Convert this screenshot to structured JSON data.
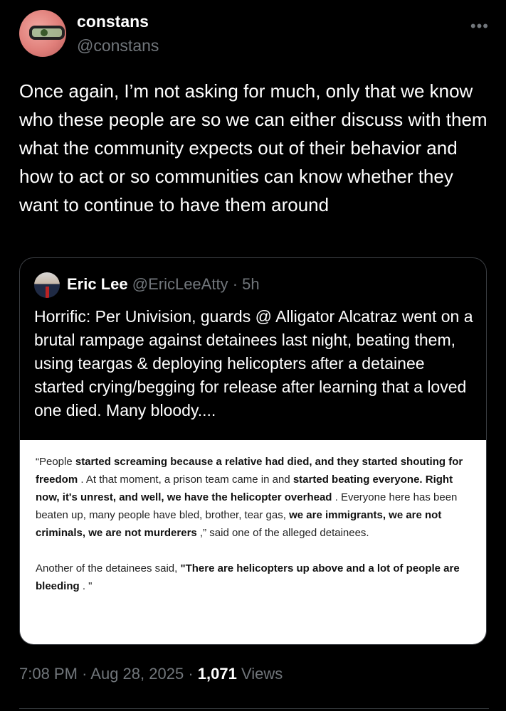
{
  "author": {
    "display_name": "constans",
    "handle": "@constans",
    "more_icon": "ellipsis-icon"
  },
  "tweet": {
    "text": "Once again, I’m not asking for much, only that we know who these people are so we can either discuss with them what the community expects out of their behavior and how to act or so communities can know whether they want to continue to have them around"
  },
  "quote": {
    "name": "Eric Lee",
    "handle": "@EricLeeAtty",
    "sep": "·",
    "time": "5h",
    "text": "Horrific: Per Univision, guards @ Alligator Alcatraz went on a brutal rampage against detainees last night, beating them, using teargas & deploying helicopters after a detainee started crying/begging for release after learning that a loved one died. Many bloody....",
    "image": {
      "p1": [
        {
          "t": "“People ",
          "b": false
        },
        {
          "t": "started screaming because a relative had died, and they started shouting for freedom",
          "b": true
        },
        {
          "t": " . At that moment, a prison team came in and ",
          "b": false
        },
        {
          "t": "started beating everyone. Right now, it's unrest, and well, we have the helicopter overhead",
          "b": true
        },
        {
          "t": " . Everyone here has been beaten up, many people have bled, brother, tear gas, ",
          "b": false
        },
        {
          "t": "we are immigrants, we are not criminals, we are not murderers",
          "b": true
        },
        {
          "t": " ,” said one of the alleged detainees.",
          "b": false
        }
      ],
      "p2": [
        {
          "t": "Another of the detainees said, ",
          "b": false
        },
        {
          "t": "\"There are helicopters up above and a lot of people are bleeding",
          "b": true
        },
        {
          "t": " . \"",
          "b": false
        }
      ]
    }
  },
  "footer": {
    "time": "7:08 PM",
    "sep1": "·",
    "date": "Aug 28, 2025",
    "sep2": "·",
    "views_count": "1,071",
    "views_label": "Views"
  }
}
